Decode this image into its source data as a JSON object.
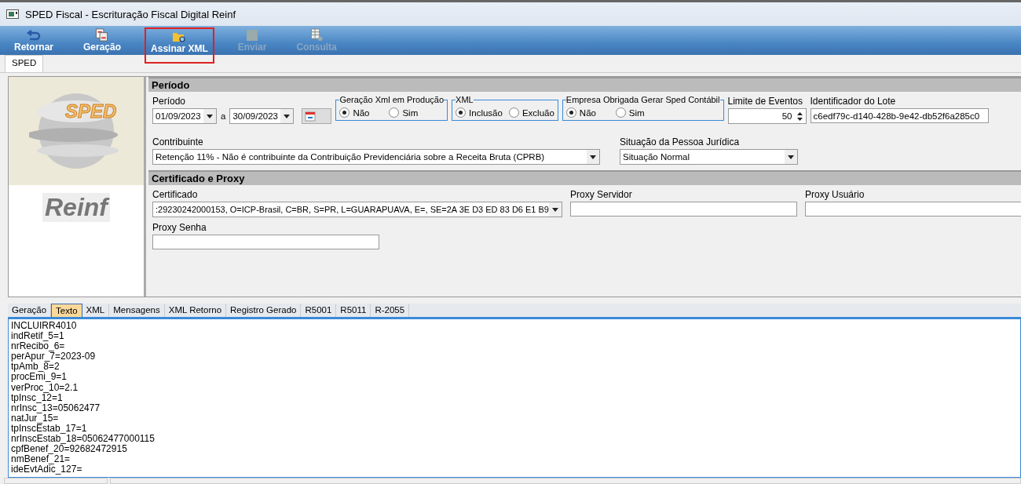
{
  "window": {
    "title": "SPED Fiscal - Escrituração Fiscal Digital Reinf"
  },
  "toolbar": [
    {
      "kind": "back",
      "label": "Retornar",
      "disabled": false,
      "highlighted": false
    },
    {
      "kind": "generate",
      "label": "Geração",
      "disabled": false,
      "highlighted": false
    },
    {
      "kind": "folder",
      "label": "Assinar XML",
      "disabled": false,
      "highlighted": true
    },
    {
      "kind": "send",
      "label": "Enviar",
      "disabled": true,
      "highlighted": false
    },
    {
      "kind": "query",
      "label": "Consulta",
      "disabled": true,
      "highlighted": false
    }
  ],
  "tabs": [
    {
      "label": "SPED",
      "selected": true
    }
  ],
  "logo": {
    "badge": "SPED",
    "caption": "Reinf"
  },
  "periodo": {
    "title": "Período",
    "label": "Período",
    "date_from": "01/09/2023",
    "separator": "a",
    "date_to": "30/09/2023",
    "radio_groups": [
      {
        "title": "Geração Xml em Produção",
        "options": [
          {
            "label": "Não",
            "selected": true
          },
          {
            "label": "Sim",
            "selected": false
          }
        ]
      },
      {
        "title": "XML",
        "options": [
          {
            "label": "Inclusão",
            "selected": true
          },
          {
            "label": "Excluão",
            "selected": false
          }
        ]
      },
      {
        "title": "Empresa Obrigada Gerar Sped Contábil",
        "options": [
          {
            "label": "Não",
            "selected": true
          },
          {
            "label": "Sim",
            "selected": false
          }
        ]
      }
    ],
    "limite": {
      "label": "Limite de Eventos",
      "value": "50"
    },
    "lote": {
      "label": "Identificador do Lote",
      "value": "c6edf79c-d140-428b-9e42-db52f6a285c0"
    },
    "contribuinte": {
      "label": "Contribuinte",
      "value": "Retenção 11% - Não é contribuinte da Contribuição Previdenciária sobre a Receita Bruta (CPRB)"
    },
    "situacao": {
      "label": "Situação da Pessoa Jurídica",
      "value": "Situação Normal"
    }
  },
  "certificado": {
    "title": "Certificado e Proxy",
    "label": "Certificado",
    "value": ":29230242000153, O=ICP-Brasil, C=BR, S=PR, L=GUARAPUAVA, E=, SE=2A 3E D3 ED 83 D6 E1 B9",
    "proxy_servidor": "Proxy Servidor",
    "proxy_usuario": "Proxy Usuário",
    "proxy_senha": "Proxy Senha"
  },
  "bottom_tabs": [
    {
      "label": "Geração",
      "selected": false
    },
    {
      "label": "Texto",
      "selected": true
    },
    {
      "label": "XML",
      "selected": false
    },
    {
      "label": "Mensagens",
      "selected": false
    },
    {
      "label": "XML Retorno",
      "selected": false
    },
    {
      "label": "Registro Gerado",
      "selected": false
    },
    {
      "label": "R5001",
      "selected": false
    },
    {
      "label": "R5011",
      "selected": false
    },
    {
      "label": "R-2055",
      "selected": false
    }
  ],
  "text_lines": [
    "INCLUIRR4010",
    "indRetif_5=1",
    "nrRecibo_6=",
    "perApur_7=2023-09",
    "tpAmb_8=2",
    "procEmi_9=1",
    "verProc_10=2.1",
    "tpInsc_12=1",
    "nrInsc_13=05062477",
    "natJur_15=",
    "tpInscEstab_17=1",
    "nrInscEstab_18=05062477000115",
    "cpfBenef_20=92682472915",
    "nmBenef_21=",
    "ideEvtAdic_127="
  ]
}
